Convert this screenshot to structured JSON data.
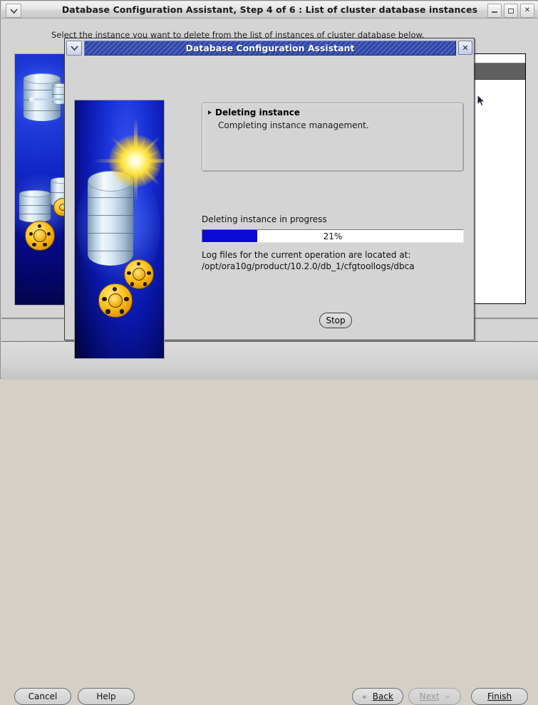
{
  "outer_window": {
    "title": "Database Configuration Assistant, Step 4 of 6 : List of cluster database instances",
    "hint_text": "Select the instance you want to delete from the list of instances of cluster database below.",
    "sysmenu_icon": "chevron-down-icon",
    "controls": {
      "minimize": "minimize-icon",
      "maximize": "maximize-icon",
      "close": "✕"
    }
  },
  "footer": {
    "cancel_label": "Cancel",
    "help_label": "Help",
    "back_label": "Back",
    "back_accel": "B",
    "next_label": "Next",
    "next_accel": "N",
    "finish_label": "Finish",
    "finish_accel": "F",
    "back_chevron": "«",
    "next_chevron": "»",
    "next_enabled": false
  },
  "dialog": {
    "title": "Database Configuration Assistant",
    "sysmenu_icon": "chevron-down-icon",
    "close_icon": "✕",
    "task": {
      "bullet": "arrow-right-icon",
      "title": "Deleting instance",
      "subtitle": "Completing instance management."
    },
    "progress": {
      "label": "Deleting instance in progress",
      "percent": 21,
      "percent_text": "21%",
      "fill_color": "#0a0ad6"
    },
    "log": {
      "line1": "Log files for the current operation are located at:",
      "line2": "/opt/ora10g/product/10.2.0/db_1/cfgtoollogs/dbca"
    },
    "stop_label": "Stop",
    "splash_icon": "oracle-database-splash-graphic"
  },
  "cursor": {
    "icon": "mouse-pointer-icon"
  },
  "colors": {
    "title_bar_blue": "#2e46a8",
    "window_face": "#d4d4d4",
    "progress_blue": "#0a0ad6",
    "table_header": "#606060"
  }
}
